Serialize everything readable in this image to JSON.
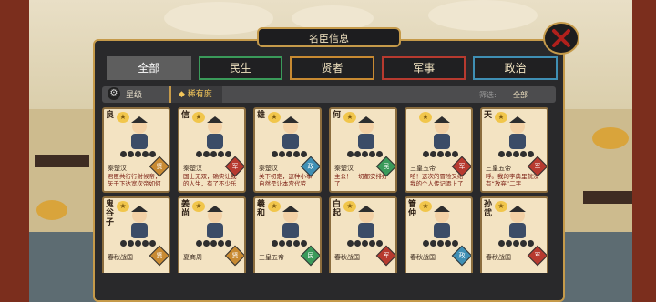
{
  "header": {
    "title": "名臣信息"
  },
  "tabs": [
    {
      "label": "全部",
      "color": "#5e5e5e",
      "active": true
    },
    {
      "label": "民生",
      "color": "#3a9a5a",
      "active": false
    },
    {
      "label": "贤者",
      "color": "#c88a32",
      "active": false
    },
    {
      "label": "军事",
      "color": "#b73a2f",
      "active": false
    },
    {
      "label": "政治",
      "color": "#3f8fb4",
      "active": false
    }
  ],
  "filter": {
    "icon": "gear-icon",
    "label": "星级",
    "sort": "稀有度",
    "right_label": "筛选:",
    "right_value": "全部"
  },
  "cards": [
    {
      "name": "良",
      "origin": "秦楚汉",
      "quote": "君臣共行行射候帝，矢千下达宽次帝如何",
      "badge": "贤",
      "badge_color": "#c88a32"
    },
    {
      "name": "信",
      "origin": "秦楚汉",
      "quote": "国士无双，确实让我的人生，有了不少乐",
      "badge": "军",
      "badge_color": "#b73a2f"
    },
    {
      "name": "雄",
      "origin": "秦楚汉",
      "quote": "关下初定，这种小事自然是让本宫代劳",
      "badge": "政",
      "badge_color": "#3f8fb4"
    },
    {
      "name": "何",
      "origin": "秦楚汉",
      "quote": "主公！一切都安排好了",
      "badge": "民",
      "badge_color": "#3a9a5a"
    },
    {
      "name": "",
      "origin": "三皇五帝",
      "quote": "哈！这次的冒险又给我的个人传记添上了",
      "badge": "军",
      "badge_color": "#b73a2f"
    },
    {
      "name": "天",
      "origin": "三皇五帝",
      "quote": "呼。我的字典里就没有“放弃”二字",
      "badge": "军",
      "badge_color": "#b73a2f"
    },
    {
      "name": "鬼谷子",
      "origin": "春秋战国",
      "quote": "",
      "badge": "贤",
      "badge_color": "#c88a32"
    },
    {
      "name": "姜尚",
      "origin": "夏商周",
      "quote": "",
      "badge": "贤",
      "badge_color": "#c88a32"
    },
    {
      "name": "羲和",
      "origin": "三皇五帝",
      "quote": "",
      "badge": "民",
      "badge_color": "#3a9a5a"
    },
    {
      "name": "白起",
      "origin": "春秋战国",
      "quote": "",
      "badge": "军",
      "badge_color": "#b73a2f"
    },
    {
      "name": "管仲",
      "origin": "春秋战国",
      "quote": "",
      "badge": "政",
      "badge_color": "#3f8fb4"
    },
    {
      "name": "孙武",
      "origin": "春秋战国",
      "quote": "",
      "badge": "军",
      "badge_color": "#b73a2f"
    }
  ]
}
